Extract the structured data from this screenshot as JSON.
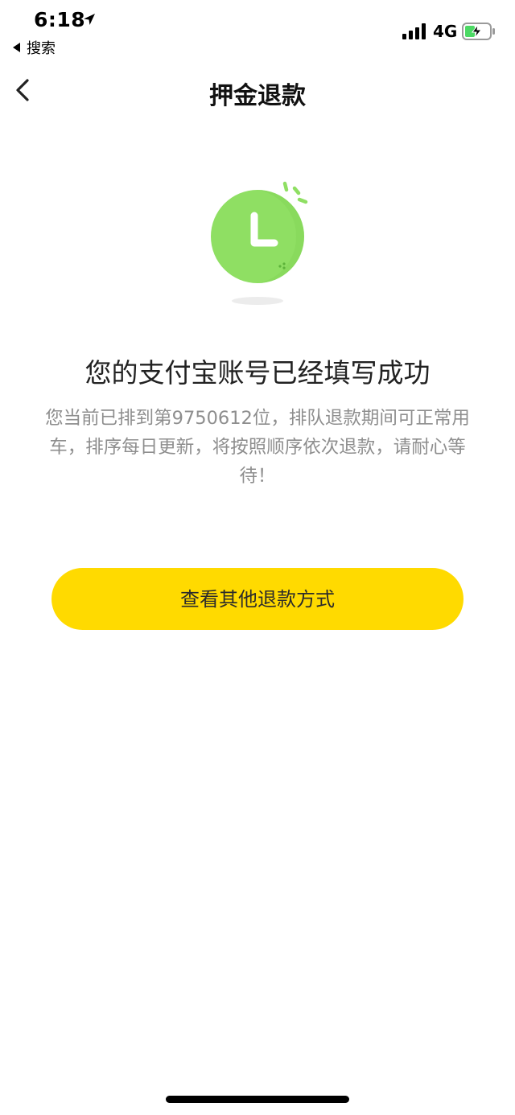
{
  "status_bar": {
    "time": "6:18",
    "back_app_label": "搜索",
    "network": "4G",
    "icons": [
      "location-arrow-icon",
      "signal-icon",
      "battery-charging-icon"
    ]
  },
  "nav": {
    "title": "押金退款",
    "back_icon": "chevron-left-icon"
  },
  "illustration": {
    "icon": "clock-icon",
    "colors": {
      "circle": "#8fdf63",
      "circle_light": "#a9ea82",
      "shadow": "#ececec"
    }
  },
  "main": {
    "headline": "您的支付宝账号已经填写成功",
    "description": "您当前已排到第9750612位，排队退款期间可正常用车，排序每日更新，将按照顺序依次退款，请耐心等待！"
  },
  "actions": {
    "other_refund_label": "查看其他退款方式"
  },
  "colors": {
    "accent": "#ffda00",
    "text_primary": "#222222",
    "text_secondary": "#8e8e8e"
  }
}
